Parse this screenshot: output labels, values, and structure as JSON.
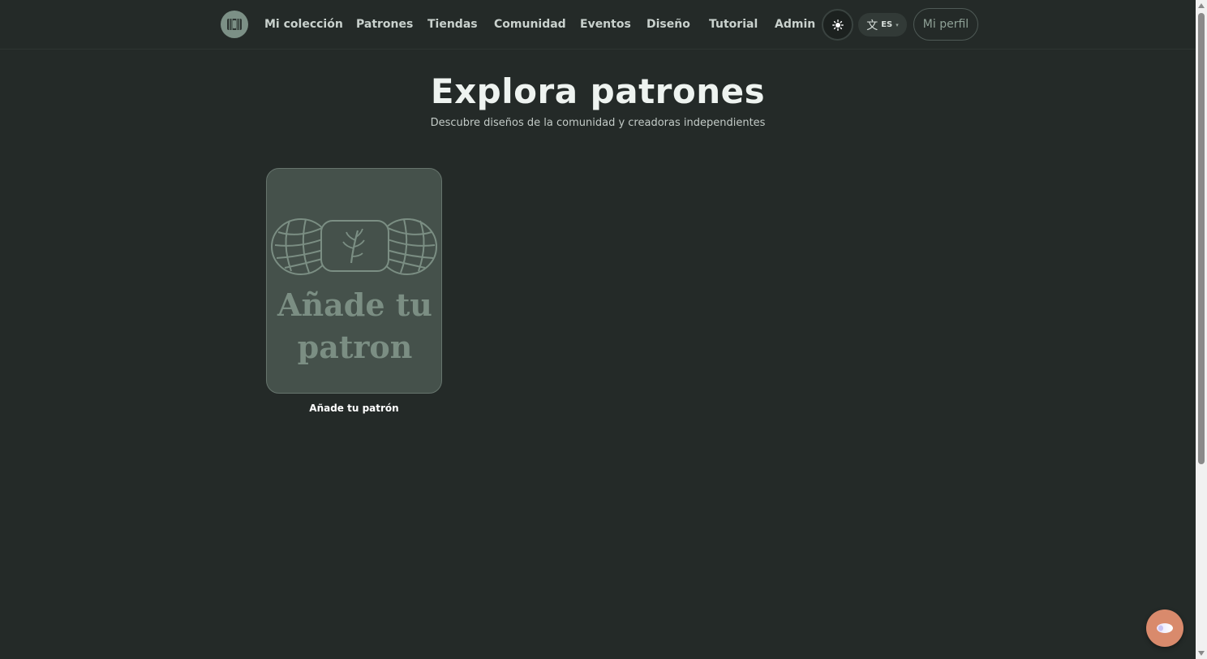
{
  "nav": {
    "logo_icon": "yarn-logo-icon",
    "links": [
      {
        "label": "Mi colección"
      },
      {
        "label": "Patrones"
      },
      {
        "label": "Tiendas"
      },
      {
        "label": "Comunidad"
      },
      {
        "label": "Eventos"
      },
      {
        "label": "Diseño"
      },
      {
        "label": "Tutorial"
      },
      {
        "label": "Admin"
      }
    ],
    "theme_icon": "sun-icon",
    "language": {
      "glyph": "文",
      "code": "ES",
      "icon": "translate-icon"
    },
    "profile_label": "Mi perfil"
  },
  "header": {
    "title": "Explora patrones",
    "subtitle": "Descubre diseños de la comunidad y creadoras independientes"
  },
  "patterns": [
    {
      "image_text": [
        "Añade tu",
        "patron"
      ],
      "caption": "Añade tu patrón",
      "image_icon": "yarn-skein-icon"
    }
  ],
  "chat_fab": {
    "icon": "chat-bubble-icon"
  },
  "colors": {
    "background": "#242a28",
    "card": "#45514b",
    "accent": "#d98a6c",
    "text": "#eef3f0"
  }
}
